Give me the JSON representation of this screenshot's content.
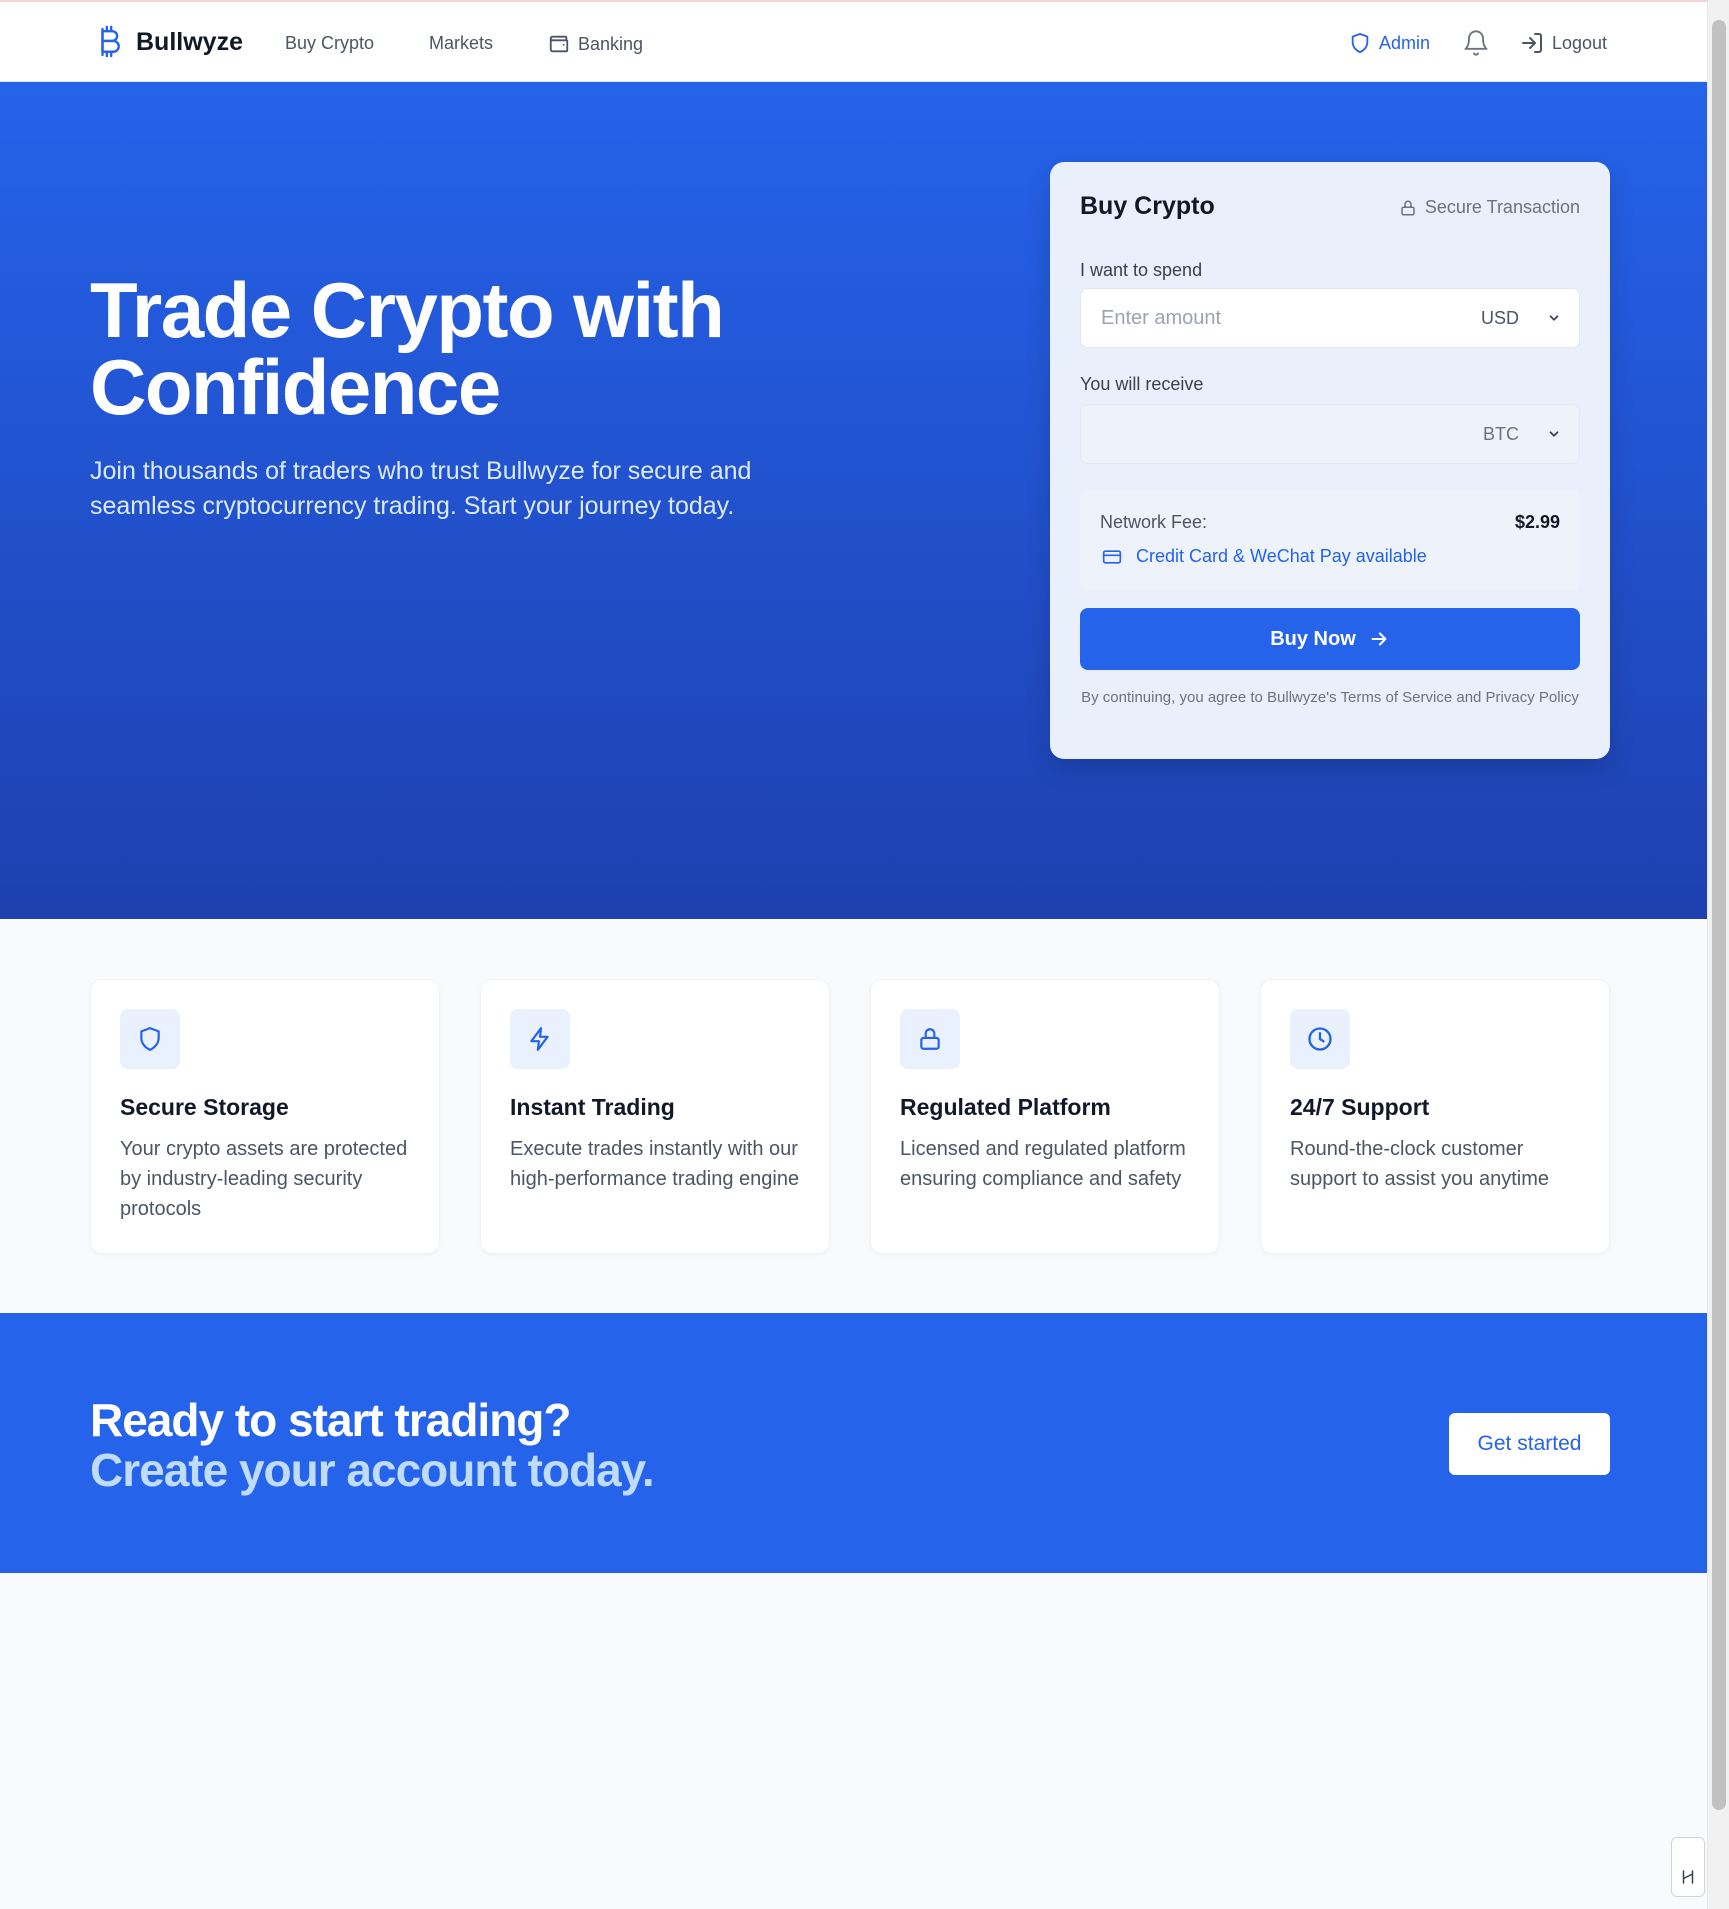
{
  "nav": {
    "brand": "Bullwyze",
    "links": [
      "Buy Crypto",
      "Markets",
      "Banking"
    ],
    "admin": "Admin",
    "logout": "Logout"
  },
  "hero": {
    "title": "Trade Crypto with Confidence",
    "subtitle": "Join thousands of traders who trust Bullwyze for secure and seamless cryptocurrency trading. Start your journey today."
  },
  "buy_card": {
    "title": "Buy Crypto",
    "secure_label": "Secure Transaction",
    "spend_label": "I want to spend",
    "spend_placeholder": "Enter amount",
    "spend_value": "",
    "spend_currency": "USD",
    "receive_label": "You will receive",
    "receive_value": "",
    "receive_currency": "BTC",
    "fee_label": "Network Fee:",
    "fee_value": "$2.99",
    "payment_note": "Credit Card & WeChat Pay available",
    "buy_button": "Buy Now",
    "legal": "By continuing, you agree to Bullwyze's Terms of Service and Privacy Policy"
  },
  "features": [
    {
      "icon": "shield-icon",
      "title": "Secure Storage",
      "desc": "Your crypto assets are protected by industry-leading security protocols"
    },
    {
      "icon": "lightning-icon",
      "title": "Instant Trading",
      "desc": "Execute trades instantly with our high-performance trading engine"
    },
    {
      "icon": "lock-icon",
      "title": "Regulated Platform",
      "desc": "Licensed and regulated platform ensuring compliance and safety"
    },
    {
      "icon": "clock-icon",
      "title": "24/7 Support",
      "desc": "Round-the-clock customer support to assist you anytime"
    }
  ],
  "cta": {
    "line1": "Ready to start trading?",
    "line2": "Create your account today.",
    "button": "Get started"
  },
  "colors": {
    "accent": "#2563eb",
    "hero_bottom": "#1e40af",
    "cta_light": "#bfdbfe"
  }
}
